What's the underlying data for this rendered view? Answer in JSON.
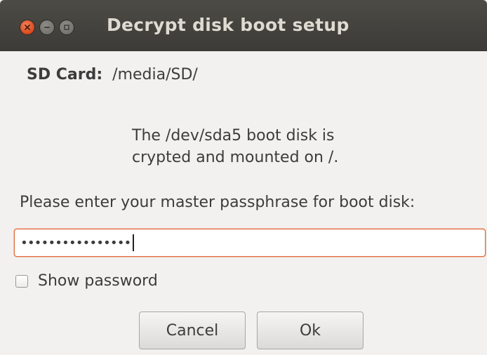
{
  "window": {
    "title": "Decrypt disk boot setup",
    "controls": {
      "close_icon": "close-icon",
      "minimize_icon": "minimize-icon",
      "maximize_icon": "maximize-icon"
    }
  },
  "sd_card": {
    "label": "SD Card:",
    "value": "/media/SD/"
  },
  "info": {
    "line1": "The /dev/sda5 boot disk is",
    "line2": "crypted and mounted on /."
  },
  "prompt": "Please enter your master passphrase for boot disk:",
  "passphrase_field": {
    "masked_value": "••••••••••••••••"
  },
  "show_password": {
    "label": "Show password",
    "checked": false
  },
  "buttons": {
    "cancel": "Cancel",
    "ok": "Ok"
  },
  "colors": {
    "titlebar": "#3d3b37",
    "close_button": "#e05a2a",
    "focus_accent": "#e4683a",
    "background": "#f2f1f0"
  }
}
